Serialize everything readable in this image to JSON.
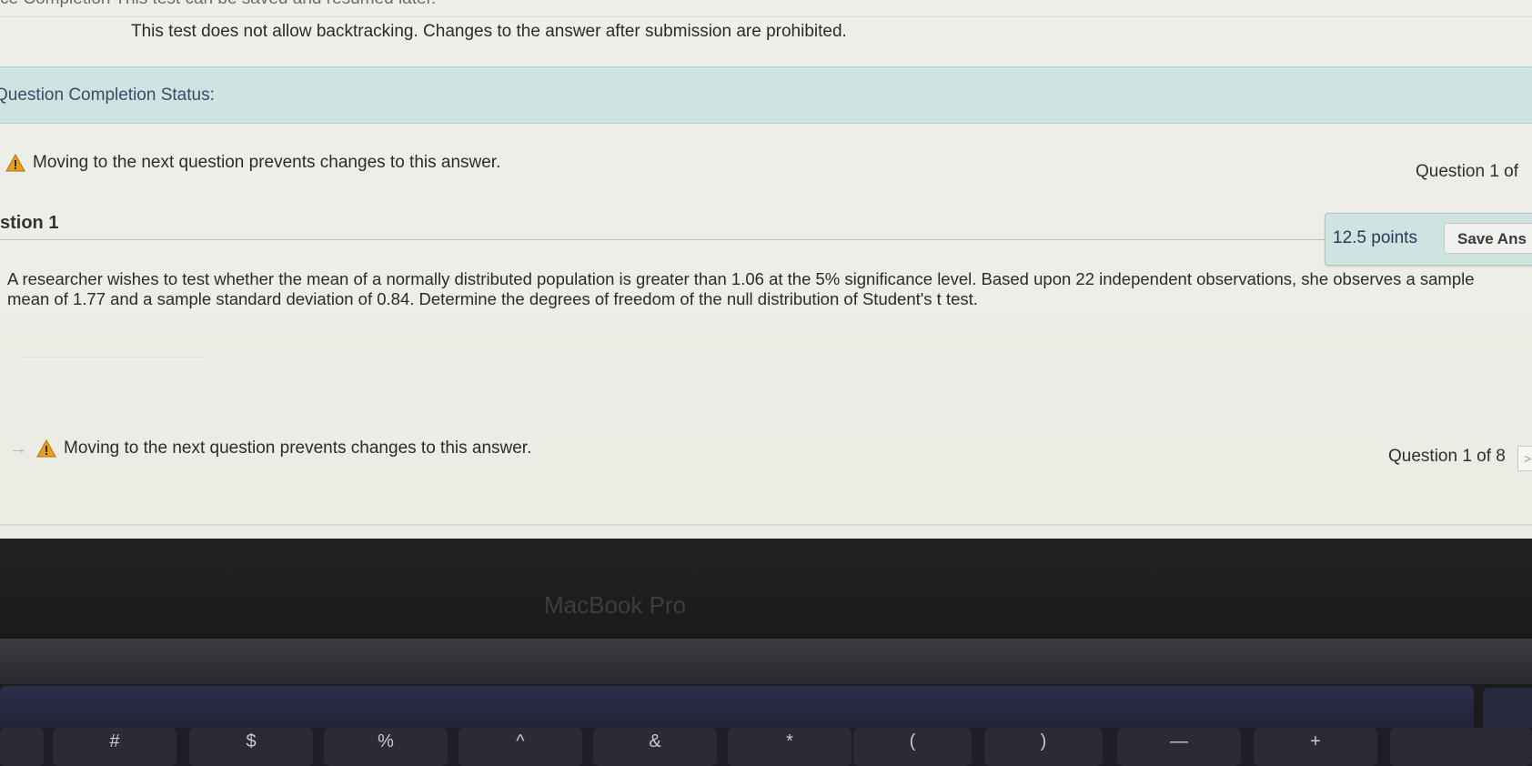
{
  "header": {
    "cut_text": "ce Completion  This test can be saved and resumed later.",
    "instructions": "This test does not allow backtracking. Changes to the answer after submission are prohibited."
  },
  "status": {
    "label": "Question Completion Status:"
  },
  "warning": {
    "text": "Moving to the next question prevents changes to this answer.",
    "icon": "warning-triangle-icon"
  },
  "navigation": {
    "counter_top": "Question 1 of",
    "counter_bottom": "Question 1 of 8",
    "next_arrow": ">",
    "prev_arrow": "→"
  },
  "question": {
    "title": "stion 1",
    "points": "12.5 points",
    "save_label": "Save Ans",
    "text": "A researcher wishes to test whether the mean of a normally distributed population is greater than 1.06 at the 5% significance level. Based upon 22 independent observations, she observes a sample mean of 1.77 and a sample standard deviation of 0.84. Determine the degrees of freedom of the null distribution of Student's t test.",
    "answer_value": ""
  },
  "device": {
    "label": "MacBook Pro"
  },
  "keyboard": {
    "keys": [
      "#",
      "$",
      "%",
      "^",
      "&",
      "*",
      "(",
      ")",
      "—",
      "+"
    ]
  },
  "colors": {
    "status_bar": "#cfe3e0",
    "warning": "#e8a21a"
  }
}
